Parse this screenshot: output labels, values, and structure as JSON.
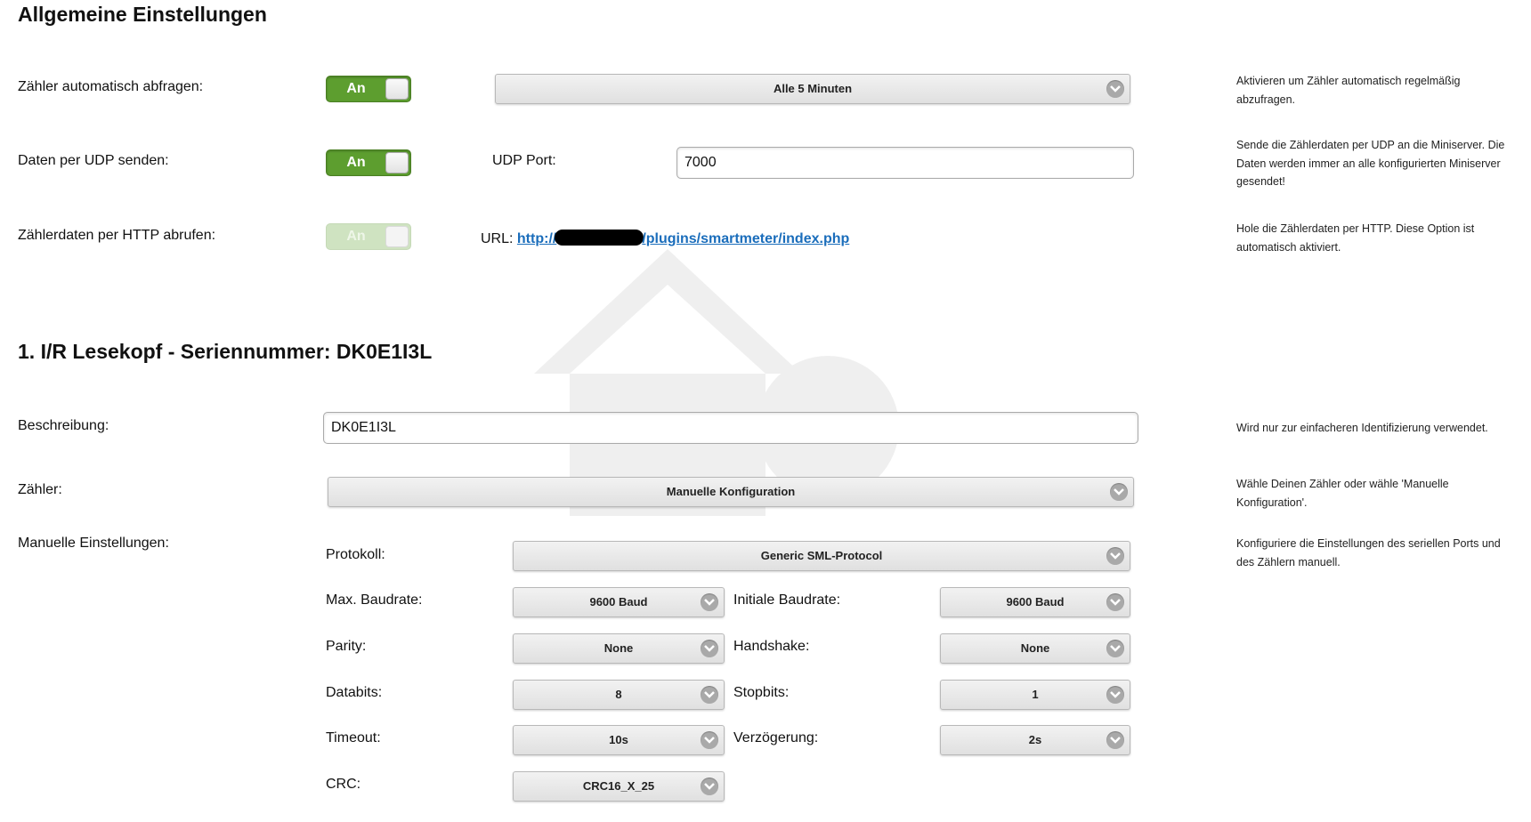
{
  "general": {
    "heading": "Allgemeine Einstellungen",
    "auto_poll": {
      "label": "Zähler automatisch abfragen:",
      "toggle": "An",
      "interval": "Alle 5 Minuten",
      "help": "Aktivieren um Zähler automatisch regelmäßig abzufragen."
    },
    "udp": {
      "label": "Daten per UDP senden:",
      "toggle": "An",
      "port_label": "UDP Port:",
      "port_value": "7000",
      "help": "Sende die Zählerdaten per UDP an die Miniserver. Die Daten werden immer an alle konfigurierten Miniserver gesendet!"
    },
    "http": {
      "label": "Zählerdaten per HTTP abrufen:",
      "toggle": "An",
      "url_label": "URL:",
      "url_prefix": "http://",
      "url_suffix": "/plugins/smartmeter/index.php",
      "help": "Hole die Zählerdaten per HTTP. Diese Option ist automatisch aktiviert."
    }
  },
  "reader": {
    "heading": "1. I/R Lesekopf - Seriennummer: DK0E1I3L",
    "description": {
      "label": "Beschreibung:",
      "value": "DK0E1I3L",
      "help": "Wird nur zur einfacheren Identifizierung verwendet."
    },
    "meter": {
      "label": "Zähler:",
      "value": "Manuelle Konfiguration",
      "help": "Wähle Deinen Zähler oder wähle 'Manuelle Konfiguration'."
    },
    "manual": {
      "label": "Manuelle Einstellungen:",
      "help": "Konfiguriere die Einstellungen des seriellen Ports und des Zählern manuell.",
      "protocol_label": "Protokoll:",
      "protocol_value": "Generic SML-Protocol",
      "max_baud_label": "Max. Baudrate:",
      "max_baud_value": "9600 Baud",
      "init_baud_label": "Initiale Baudrate:",
      "init_baud_value": "9600 Baud",
      "parity_label": "Parity:",
      "parity_value": "None",
      "handshake_label": "Handshake:",
      "handshake_value": "None",
      "databits_label": "Databits:",
      "databits_value": "8",
      "stopbits_label": "Stopbits:",
      "stopbits_value": "1",
      "timeout_label": "Timeout:",
      "timeout_value": "10s",
      "delay_label": "Verzögerung:",
      "delay_value": "2s",
      "crc_label": "CRC:",
      "crc_value": "CRC16_X_25"
    }
  },
  "colors": {
    "toggle_on": "#5d9e2f",
    "link": "#1a6dbb"
  }
}
